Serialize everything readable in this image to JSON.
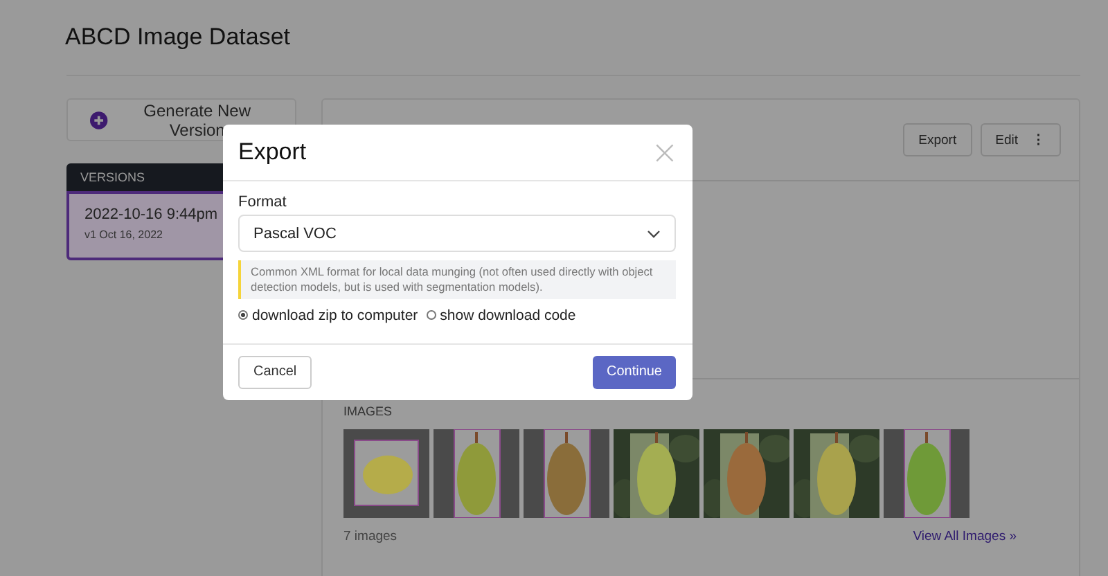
{
  "page": {
    "title": "ABCD Image Dataset"
  },
  "sidebar": {
    "generate_button": "Generate New Version",
    "versions_heading": "VERSIONS",
    "versions": [
      {
        "title": "2022-10-16 9:44pm",
        "subtitle": "v1 Oct 16, 2022",
        "selected": true
      }
    ]
  },
  "panel": {
    "buttons": [
      {
        "label": "Export",
        "kind": "plain"
      },
      {
        "label": "Edit",
        "kind": "menu",
        "icon": "⋮"
      }
    ],
    "images_heading": "IMAGES",
    "image_count": "7 images",
    "view_all_link": "View All Images",
    "view_all_icon": "»"
  },
  "modal": {
    "title": "Export",
    "close_icon": "×",
    "format_label": "Format",
    "format_value": "Pascal VOC",
    "note": "Common XML format for local data munging (not often used directly with object detection models, but is used with segmentation models).",
    "options": [
      {
        "label": "download zip to computer",
        "selected": true
      },
      {
        "label": "show download code",
        "selected": false
      }
    ],
    "cancel": "Cancel",
    "continue": "Continue"
  }
}
